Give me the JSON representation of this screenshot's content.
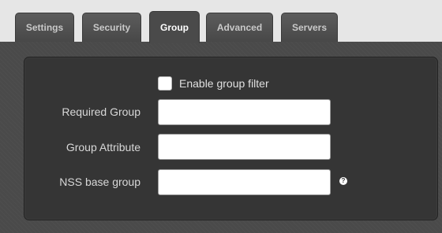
{
  "tabs": [
    {
      "label": "Settings",
      "active": false
    },
    {
      "label": "Security",
      "active": false
    },
    {
      "label": "Group",
      "active": true
    },
    {
      "label": "Advanced",
      "active": false
    },
    {
      "label": "Servers",
      "active": false
    }
  ],
  "form": {
    "enable_group_filter": {
      "label": "Enable group filter",
      "checked": false
    },
    "required_group": {
      "label": "Required Group",
      "value": ""
    },
    "group_attribute": {
      "label": "Group Attribute",
      "value": ""
    },
    "nss_base_group": {
      "label": "NSS base group",
      "value": "",
      "help_icon": "question-circle-icon"
    }
  },
  "colors": {
    "background": "#4a4a4a",
    "panel": "#353535",
    "tab_inactive": "#555555",
    "tab_active_text": "#ffffff"
  }
}
